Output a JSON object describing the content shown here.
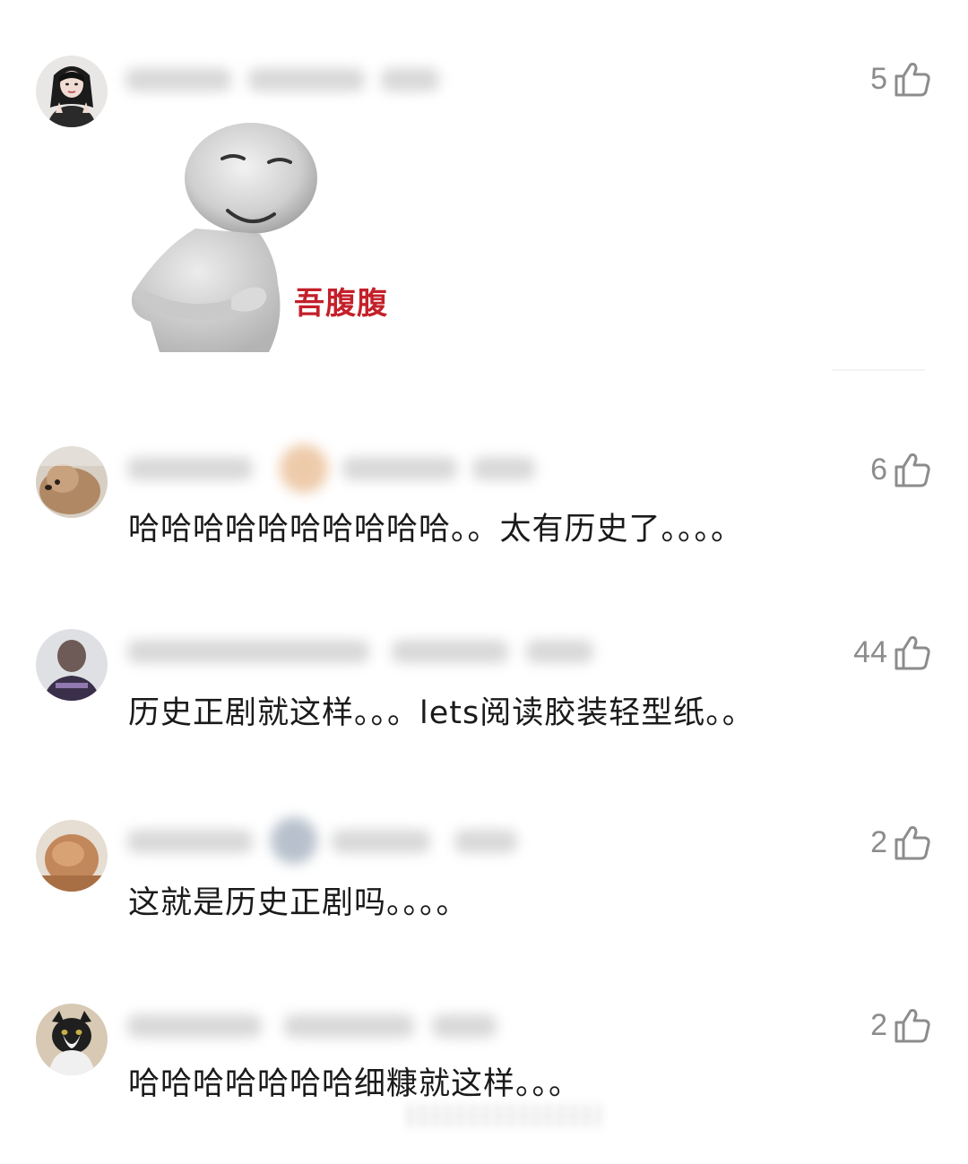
{
  "comments": [
    {
      "avatar_icon": "avatar-woman-photo-icon",
      "likes": "5",
      "text": "",
      "image": {
        "icon": "smiling-3d-figure-meme-icon",
        "caption": "吾腹腹"
      }
    },
    {
      "avatar_icon": "avatar-dog-photo-icon",
      "likes": "6",
      "text": "哈哈哈哈哈哈哈哈哈哈。。太有历史了。。。。"
    },
    {
      "avatar_icon": "avatar-person-photo-icon",
      "likes": "44",
      "text": "历史正剧就这样。。。lets阅读胶装轻型纸。。"
    },
    {
      "avatar_icon": "avatar-pet-photo-icon",
      "likes": "2",
      "text": "这就是历史正剧吗。。。。"
    },
    {
      "avatar_icon": "avatar-cat-photo-icon",
      "likes": "2",
      "text": "哈哈哈哈哈哈哈细糠就这样。。。"
    }
  ],
  "colors": {
    "text": "#1a1a1a",
    "like_gray": "#8c8c8c",
    "caption_red": "#c4202a"
  }
}
